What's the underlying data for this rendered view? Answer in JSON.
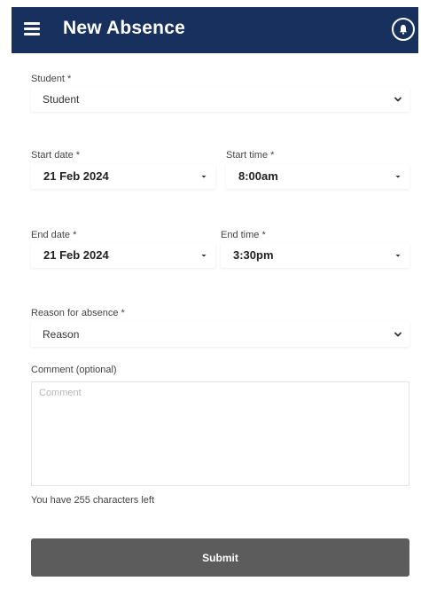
{
  "header": {
    "title": "New Absence",
    "menu_icon": "hamburger-menu-icon",
    "notification_icon": "bell-icon",
    "background_color": "#17305e"
  },
  "form": {
    "student": {
      "label": "Student *",
      "value": "Student"
    },
    "start_date": {
      "label": "Start date *",
      "value": "21 Feb 2024"
    },
    "start_time": {
      "label": "Start time *",
      "value": "8:00am"
    },
    "end_date": {
      "label": "End date *",
      "value": "21 Feb 2024"
    },
    "end_time": {
      "label": "End time *",
      "value": "3:30pm"
    },
    "reason": {
      "label": "Reason for absence *",
      "value": "Reason"
    },
    "comment": {
      "label": "Comment (optional)",
      "placeholder": "Comment",
      "value": ""
    },
    "chars_left": "You have 255 characters left",
    "submit_label": "Submit",
    "submit_color": "#5c5c5c"
  }
}
